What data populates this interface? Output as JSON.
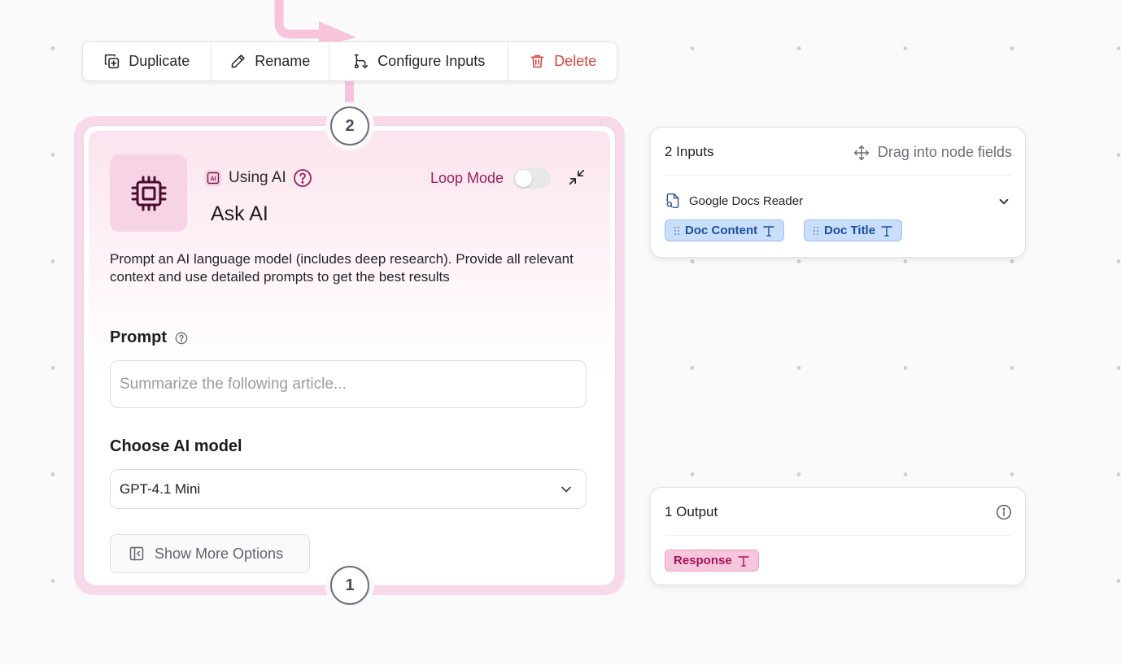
{
  "toolbar": {
    "duplicate": "Duplicate",
    "rename": "Rename",
    "configure": "Configure Inputs",
    "delete": "Delete"
  },
  "steps": {
    "top": "2",
    "bottom": "1"
  },
  "node": {
    "badge": "Using AI",
    "title": "Ask AI",
    "loop_label": "Loop Mode",
    "loop_enabled": false,
    "description": "Prompt an AI language model (includes deep research). Provide all relevant context and use detailed prompts to get the best results",
    "prompt_label": "Prompt",
    "prompt_placeholder": "Summarize the following article...",
    "model_label": "Choose AI model",
    "model_value": "GPT-4.1 Mini",
    "more_options": "Show More Options"
  },
  "inputs_panel": {
    "title": "2 Inputs",
    "hint": "Drag into node fields",
    "source": "Google Docs Reader",
    "fields": [
      "Doc Content",
      "Doc Title"
    ]
  },
  "outputs_panel": {
    "title": "1 Output",
    "fields": [
      "Response"
    ]
  },
  "colors": {
    "accent": "#9c1f5d",
    "delete": "#d9473e",
    "input_tag": "#c9defa",
    "output_tag": "#f7c6dd"
  }
}
